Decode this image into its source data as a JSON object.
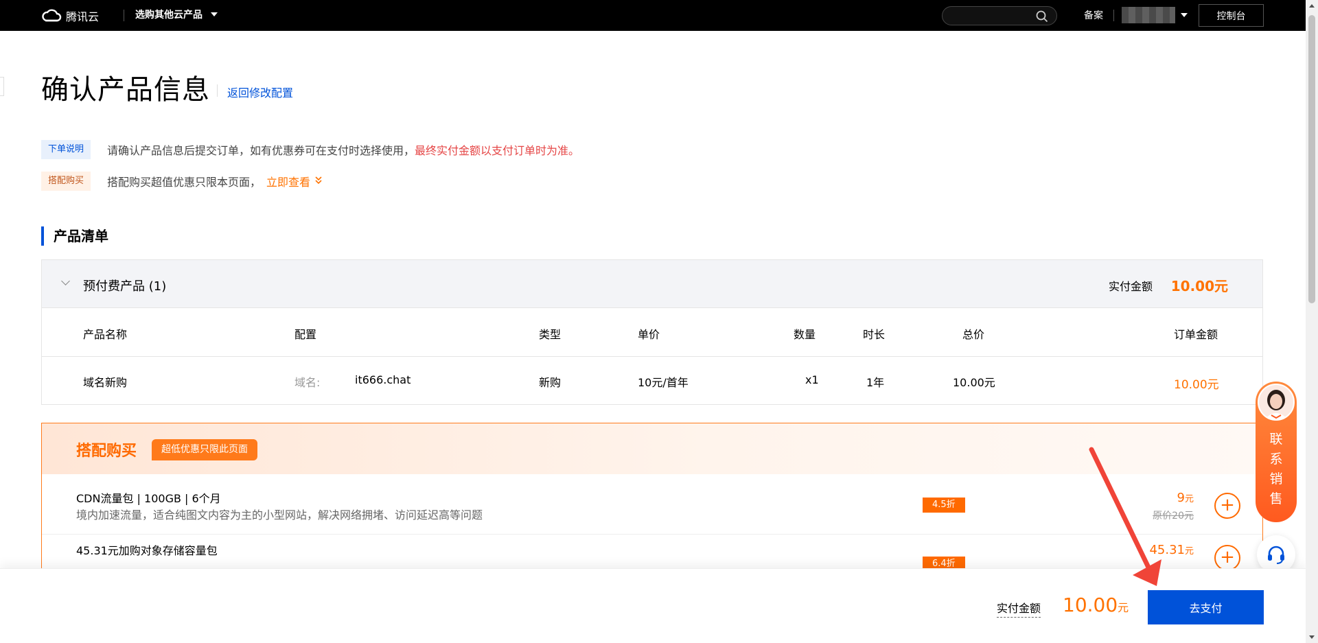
{
  "topbar": {
    "brand": "腾讯云",
    "products_menu": "选购其他云产品",
    "search_placeholder": "",
    "beian": "备案",
    "console": "控制台"
  },
  "heading": {
    "title": "确认产品信息",
    "back_link": "返回修改配置"
  },
  "notices": [
    {
      "tag": "下单说明",
      "text": "请确认产品信息后提交订单，如有优惠券可在支付时选择使用，",
      "highlight": "最终实付金额以支付订单时为准。"
    },
    {
      "tag": "搭配购买",
      "text": "搭配购买超值优惠只限本页面，",
      "link": "立即查看"
    }
  ],
  "product_list": {
    "title": "产品清单",
    "group_label": "预付费产品 (1)",
    "pay_label": "实付金额",
    "pay_value": "10.00元",
    "columns": [
      "产品名称",
      "配置",
      "类型",
      "单价",
      "数量",
      "时长",
      "总价",
      "订单金额"
    ],
    "rows": [
      {
        "name": "域名新购",
        "config_key": "域名:",
        "config_value": "it666.chat",
        "type": "新购",
        "unit_price": "10元/首年",
        "quantity": "x1",
        "duration": "1年",
        "total": "10.00元",
        "order_amount": "10.00元"
      }
    ]
  },
  "bundle": {
    "title": "搭配购买",
    "badge": "超低优惠只限此页面",
    "items": [
      {
        "name": "CDN流量包 | 100GB | 6个月",
        "desc": "境内加速流量，适合纯图文内容为主的小型网站，解决网络拥堵、访问延迟高等问题",
        "discount": "4.5折",
        "price": "9",
        "price_unit": "元",
        "original": "原价20元"
      },
      {
        "name": "45.31元加购对象存储容量包",
        "desc": "",
        "discount": "6.4折",
        "price": "45.31",
        "price_unit": "元",
        "original": ""
      }
    ]
  },
  "bottom": {
    "label": "实付金额",
    "amount": "10.00",
    "unit": "元",
    "pay_button": "去支付"
  },
  "sales_widget": {
    "label": "联系销售"
  },
  "colors": {
    "brand_blue": "#0052d9",
    "accent_orange": "#ff7200",
    "warning_red": "#e54545",
    "annotation_red": "#f04438"
  }
}
